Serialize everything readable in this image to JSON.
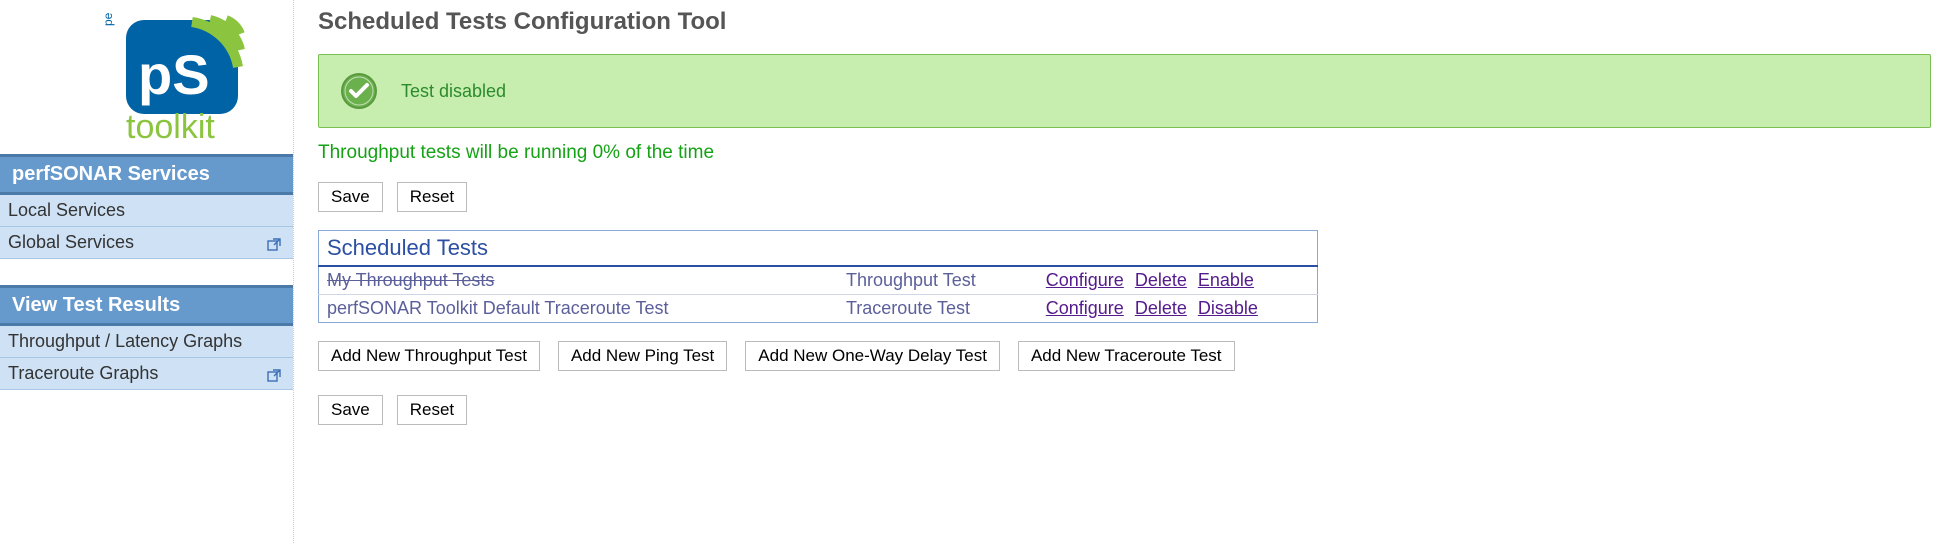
{
  "logo": {
    "brand_top": "performance",
    "brand_badge": "pS",
    "brand_bottom": "toolkit"
  },
  "sidebar": {
    "sections": [
      {
        "header": "perfSONAR Services",
        "items": [
          {
            "label": "Local Services",
            "ext": false
          },
          {
            "label": "Global Services",
            "ext": true
          }
        ]
      },
      {
        "header": "View Test Results",
        "items": [
          {
            "label": "Throughput / Latency Graphs",
            "ext": false
          },
          {
            "label": "Traceroute Graphs",
            "ext": true
          }
        ]
      }
    ]
  },
  "page": {
    "title": "Scheduled Tests Configuration Tool"
  },
  "alert": {
    "text": "Test disabled"
  },
  "status_line": "Throughput tests will be running 0% of the time",
  "buttons": {
    "save": "Save",
    "reset": "Reset"
  },
  "tests": {
    "caption": "Scheduled Tests",
    "rows": [
      {
        "name": "My Throughput Tests",
        "type": "Throughput Test",
        "disabled": true,
        "actions": {
          "configure": "Configure",
          "delete": "Delete",
          "toggle": "Enable"
        }
      },
      {
        "name": "perfSONAR Toolkit Default Traceroute Test",
        "type": "Traceroute Test",
        "disabled": false,
        "actions": {
          "configure": "Configure",
          "delete": "Delete",
          "toggle": "Disable"
        }
      }
    ]
  },
  "add_buttons": {
    "throughput": "Add New Throughput Test",
    "ping": "Add New Ping Test",
    "owdelay": "Add New One-Way Delay Test",
    "traceroute": "Add New Traceroute Test"
  }
}
